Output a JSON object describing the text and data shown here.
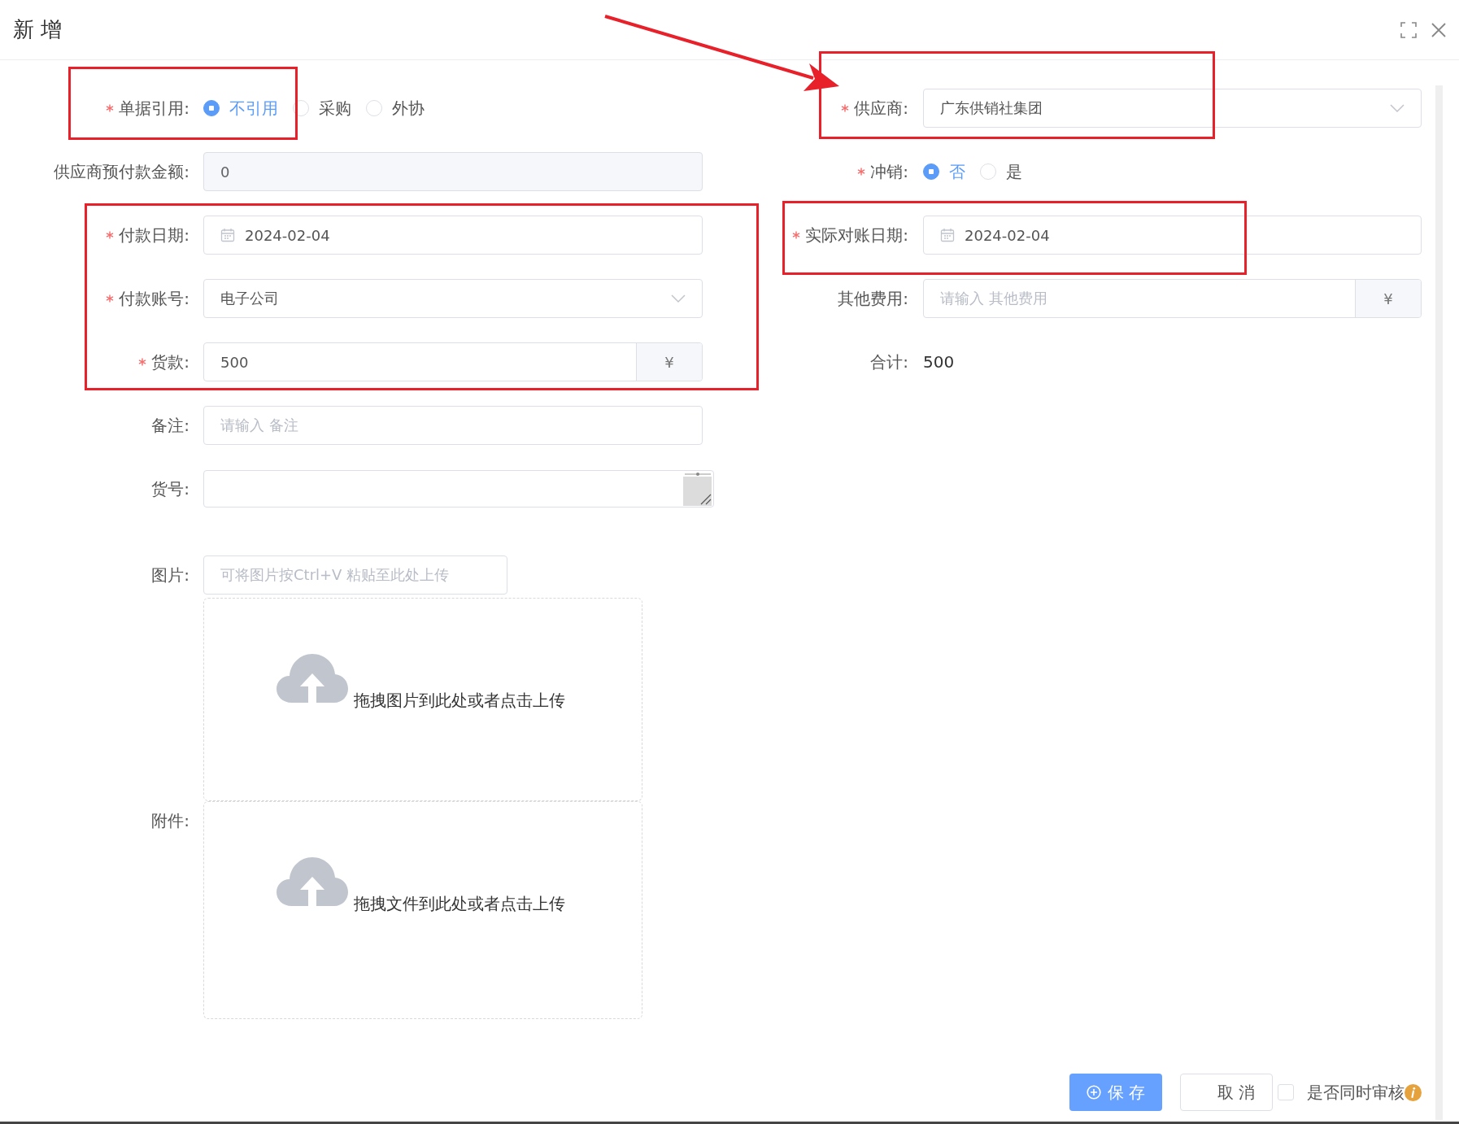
{
  "dialog": {
    "title": "新 增"
  },
  "left_fields": [
    {
      "kind": "radio",
      "label": "单据引用:",
      "required": true,
      "options": [
        {
          "label": "不引用",
          "selected": true
        },
        {
          "label": "采购",
          "selected": false
        },
        {
          "label": "外协",
          "selected": false
        }
      ]
    },
    {
      "kind": "input",
      "label": "供应商预付款金额:",
      "required": false,
      "disabled": true,
      "value": "0"
    },
    {
      "kind": "date",
      "label": "付款日期:",
      "required": true,
      "value": "2024-02-04"
    },
    {
      "kind": "select",
      "label": "付款账号:",
      "required": true,
      "value": "电子公司"
    },
    {
      "kind": "addon",
      "label": "货款:",
      "required": true,
      "value": "500",
      "addon": "¥"
    },
    {
      "kind": "input",
      "label": "备注:",
      "required": false,
      "placeholder": "请输入 备注"
    },
    {
      "kind": "textarea",
      "label": "货号:",
      "required": false
    },
    {
      "kind": "image",
      "label": "图片:",
      "required": false,
      "placeholder": "可将图片按Ctrl+V 粘贴至此处上传",
      "upload_hint": "拖拽图片到此处或者点击上传"
    },
    {
      "kind": "upload",
      "label": "附件:",
      "required": false,
      "upload_hint": "拖拽文件到此处或者点击上传"
    }
  ],
  "right_fields": [
    {
      "kind": "select",
      "label": "供应商:",
      "required": true,
      "value": "广东供销社集团"
    },
    {
      "kind": "radio",
      "label": "冲销:",
      "required": true,
      "options": [
        {
          "label": "否",
          "selected": true
        },
        {
          "label": "是",
          "selected": false
        }
      ]
    },
    {
      "kind": "date",
      "label": "实际对账日期:",
      "required": true,
      "value": "2024-02-04"
    },
    {
      "kind": "addon",
      "label": "其他费用:",
      "required": false,
      "placeholder": "请输入 其他费用",
      "addon": "¥"
    },
    {
      "kind": "text",
      "label": "合计:",
      "required": false,
      "value": "500"
    }
  ],
  "footer": {
    "save_button": "保 存",
    "cancel_button": "取 消",
    "review_checkbox": {
      "label": "是否同时审核",
      "checked": false
    }
  }
}
